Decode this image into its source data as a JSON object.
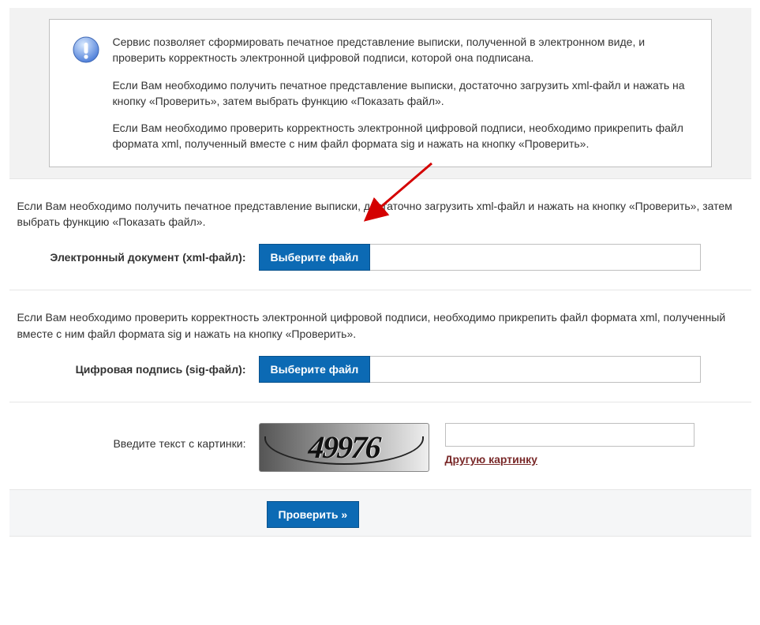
{
  "info": {
    "p1": "Сервис позволяет сформировать печатное представление выписки, полученной в электронном виде, и проверить корректность электронной цифровой подписи, которой она подписана.",
    "p2": "Если Вам необходимо получить печатное представление выписки, достаточно загрузить xml-файл и нажать на кнопку «Проверить», затем выбрать функцию «Показать файл».",
    "p3": "Если Вам необходимо проверить корректность электронной цифровой подписи, необходимо прикрепить файл формата xml, полученный вместе с ним файл формата sig и нажать на кнопку «Проверить»."
  },
  "xml": {
    "hint": "Если Вам необходимо получить печатное представление выписки, достаточно загрузить xml-файл и нажать на кнопку «Проверить», затем выбрать функцию «Показать файл».",
    "label": "Электронный документ (xml-файл):",
    "button": "Выберите файл"
  },
  "sig": {
    "hint": "Если Вам необходимо проверить корректность электронной цифровой подписи, необходимо прикрепить файл формата xml, полученный вместе с ним файл формата sig и нажать на кнопку «Проверить».",
    "label": "Цифровая подпись (sig-файл):",
    "button": "Выберите файл"
  },
  "captcha": {
    "label": "Введите текст с картинки:",
    "digits": "49976",
    "refresh": "Другую картинку"
  },
  "submit": {
    "label": "Проверить »"
  }
}
